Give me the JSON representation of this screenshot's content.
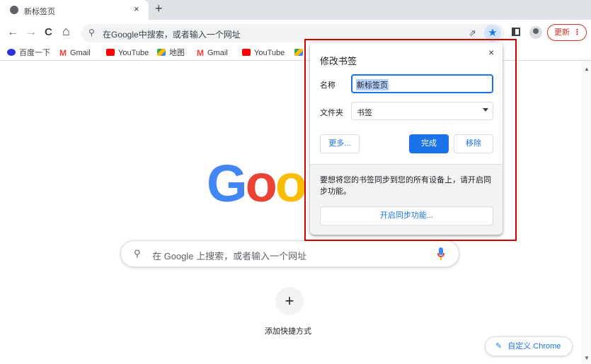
{
  "tab": {
    "title": "新标签页",
    "close": "×",
    "new_tab": "+"
  },
  "toolbar": {
    "back": "←",
    "forward": "→",
    "reload": "C",
    "home": "⌂",
    "omnibox_icon": "⚲",
    "omnibox_placeholder": "在Google中搜索，或者输入一个网址",
    "share": "⇗",
    "star": "★",
    "update_label": "更新",
    "menu": "⋮"
  },
  "bookmarks": [
    {
      "label": "百度一下",
      "icon": "baidu-icon"
    },
    {
      "label": "Gmail",
      "icon": "gmail-icon"
    },
    {
      "label": "YouTube",
      "icon": "youtube-icon"
    },
    {
      "label": "地图",
      "icon": "maps-icon"
    },
    {
      "label": "Gmail",
      "icon": "gmail-icon"
    },
    {
      "label": "YouTube",
      "icon": "youtube-icon"
    }
  ],
  "gmail_glyph": "M",
  "logo_text": [
    "G",
    "o",
    "o"
  ],
  "colors": {
    "blue": "#4285f4",
    "red": "#ea4335",
    "yellow": "#fbbc04",
    "green": "#34a853",
    "accent": "#1a73e8",
    "annotation": "#d50000"
  },
  "search": {
    "icon": "⚲",
    "placeholder": "在 Google 上搜索，或者输入一个网址"
  },
  "shortcut": {
    "add_icon": "+",
    "label": "添加快捷方式"
  },
  "customize": {
    "icon": "✎",
    "label": "自定义 Chrome"
  },
  "bubble": {
    "title": "修改书签",
    "close": "×",
    "name_label": "名称",
    "name_value": "新标签页",
    "folder_label": "文件夹",
    "folder_value": "书签",
    "more_button": "更多...",
    "done_button": "完成",
    "remove_button": "移除",
    "sync_message": "要想将您的书签同步到您的所有设备上，请开启同步功能。",
    "sync_button": "开启同步功能..."
  },
  "scrollbar": {
    "up": "▲",
    "down": "▼"
  }
}
